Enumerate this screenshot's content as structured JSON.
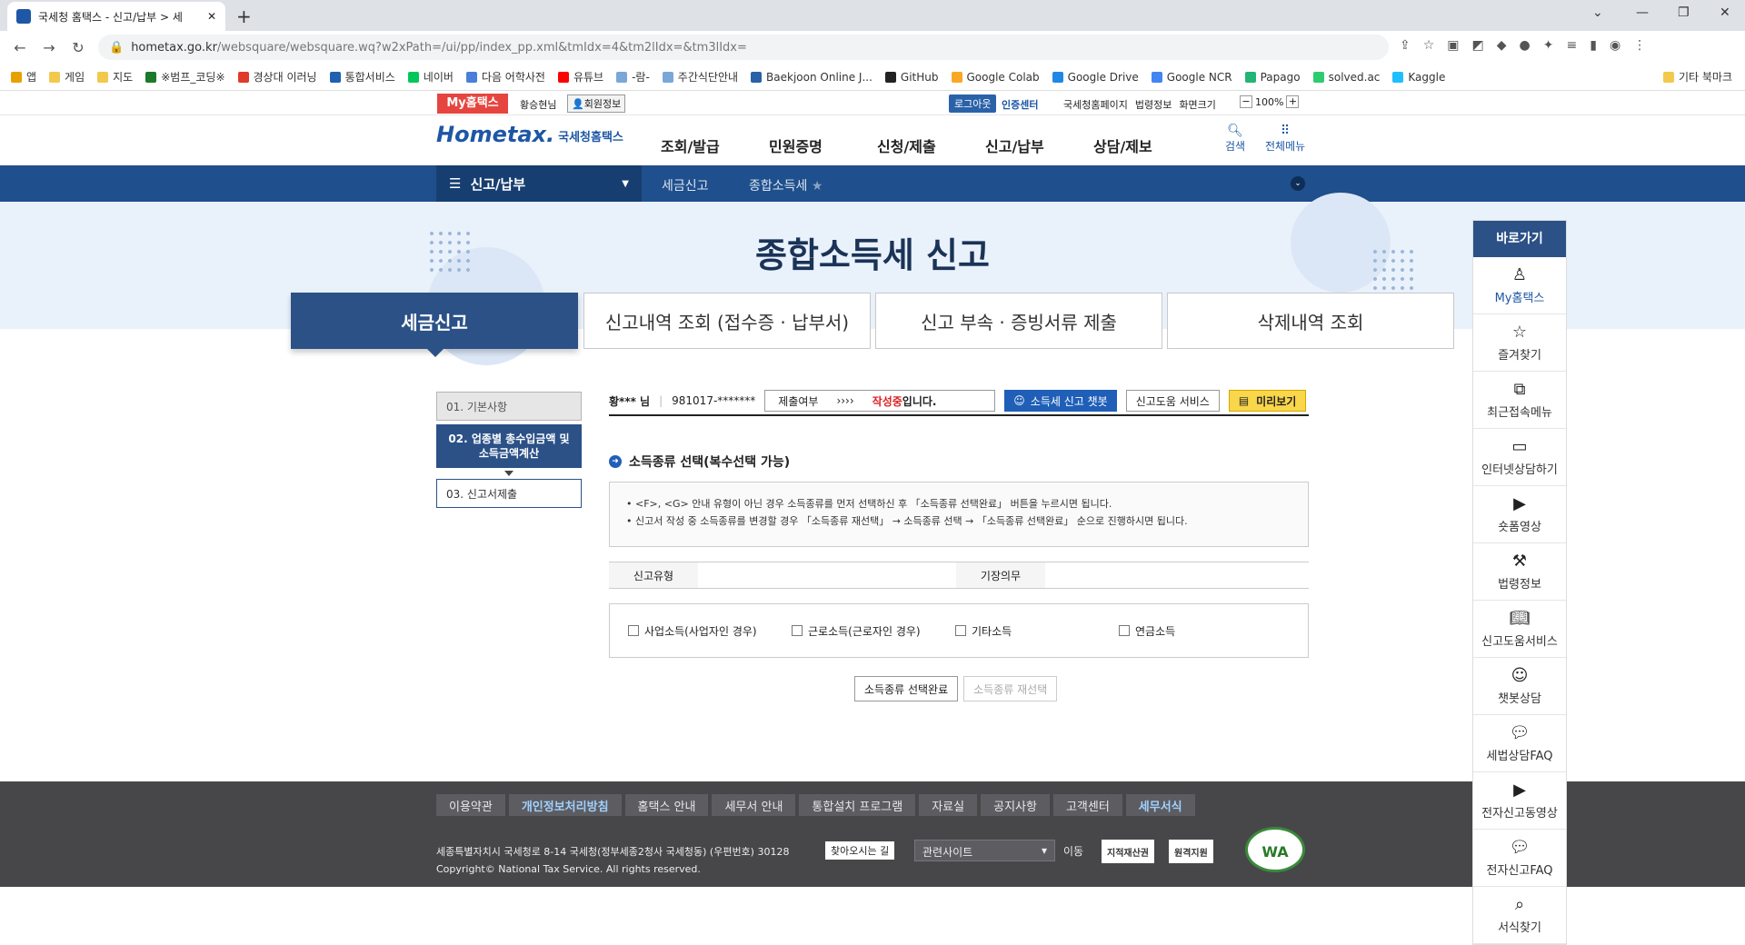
{
  "browser": {
    "tab_title": "국세청 홈택스 - 신고/납부 > 세",
    "url_host": "hometax.go.kr",
    "url_path": "/websquare/websquare.wq?w2xPath=/ui/pp/index_pp.xml&tmIdx=4&tm2lIdx=&tm3lIdx=",
    "bookmarks": [
      "앱",
      "게임",
      "지도",
      "※범프_코딩※",
      "경상대 이러닝",
      "통합서비스",
      "네이버",
      "다음 어학사전",
      "유튜브",
      "-람-",
      "주간식단안내",
      "Baekjoon Online J...",
      "GitHub",
      "Google Colab",
      "Google Drive",
      "Google NCR",
      "Papago",
      "solved.ac",
      "Kaggle",
      "기타 북마크"
    ]
  },
  "util": {
    "my_hometax": "My홈택스",
    "user_name": "황승현님",
    "member_info": "회원정보",
    "logout": "로그아웃",
    "cert_center": "인증센터",
    "links": [
      "국세청홈페이지",
      "법령정보",
      "화면크기"
    ],
    "zoom_minus": "−",
    "zoom_value": "100%",
    "zoom_plus": "+"
  },
  "header": {
    "logo_text": "Hometax.",
    "logo_kr": "국세청홈택스",
    "gnb": [
      "조회/발급",
      "민원증명",
      "신청/제출",
      "신고/납부",
      "상담/제보"
    ],
    "search": "검색",
    "all_menu": "전체메뉴"
  },
  "bluenav": {
    "current": "신고/납부",
    "crumbs": [
      "세금신고",
      "종합소득세"
    ]
  },
  "hero": {
    "title": "종합소득세 신고"
  },
  "tabs": [
    "세금신고",
    "신고내역 조회 (접수증 · 납부서)",
    "신고 부속 · 증빙서류 제출",
    "삭제내역 조회"
  ],
  "steps": [
    "01. 기본사항",
    "02. 업종별 총수입금액 및 소득금액계산",
    "03. 신고서제출"
  ],
  "userbar": {
    "name": "황*** 님",
    "id": "981017-*******",
    "submit_label": "제출여부",
    "submit_arrows": "››››",
    "submit_status": "작성중",
    "submit_suffix": "입니다.",
    "chatbot": "소득세 신고 챗봇",
    "help": "신고도움 서비스",
    "preview": "미리보기"
  },
  "section": {
    "title": "소득종류 선택(복수선택 가능)",
    "notice": [
      "• <F>, <G> 안내 유형이 아닌 경우 소득종류를 먼저 선택하신 후 「소득종류 선택완료」 버튼을 누르시면 됩니다.",
      "• 신고서 작성 중 소득종류를 변경할 경우 「소득종류 재선택」 → 소득종류 선택 → 「소득종류 선택완료」 순으로 진행하시면 됩니다."
    ],
    "type_label": "신고유형",
    "duty_label": "기장의무",
    "checks": [
      "사업소득(사업자인 경우)",
      "근로소득(근로자인 경우)",
      "기타소득",
      "연금소득"
    ],
    "btn_done": "소득종류 선택완료",
    "btn_reselect": "소득종류 재선택"
  },
  "footer": {
    "links": [
      "이용약관",
      "개인정보처리방침",
      "홈택스 안내",
      "세무서 안내",
      "통합설치 프로그램",
      "자료실",
      "공지사항",
      "고객센터",
      "세무서식"
    ],
    "address": "세종특별자치시 국세청로 8-14 국세청(정부세종2청사 국세청동) (우편번호) 30128",
    "find_way": "찾아오시는 길",
    "copyright": "Copyright© National Tax Service. All rights reserved.",
    "related": "관련사이트",
    "move": "이동",
    "badge1": "지적재산권",
    "badge2": "원격지원",
    "wa": "WA"
  },
  "quick": {
    "header": "바로가기",
    "items": [
      "My홈택스",
      "즐겨찾기",
      "최근접속메뉴",
      "인터넷상담하기",
      "숏폼영상",
      "법령정보",
      "신고도움서비스",
      "챗봇상담",
      "세법상담FAQ",
      "전자신고동영상",
      "전자신고FAQ",
      "서식찾기"
    ]
  }
}
